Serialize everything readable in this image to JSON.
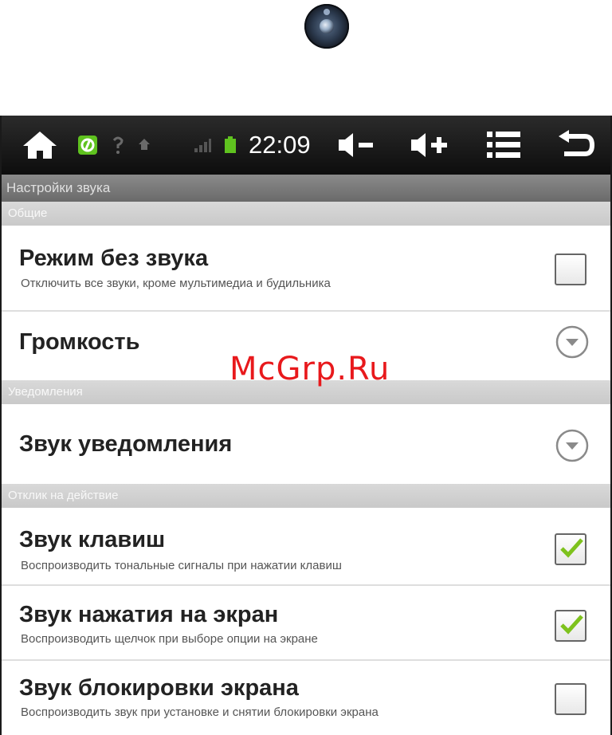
{
  "status_bar": {
    "time": "22:09",
    "icons": [
      "home-icon",
      "app-icon",
      "wifi-icon",
      "notification-icon",
      "signal-icon",
      "battery-icon",
      "volume-down-icon",
      "volume-up-icon",
      "menu-icon",
      "back-icon"
    ]
  },
  "title": "Настройки звука",
  "sections": {
    "general": "Общие",
    "notifications": "Уведомления",
    "feedback": "Отклик на действие"
  },
  "prefs": {
    "silent": {
      "title": "Режим без звука",
      "summary": "Отключить все звуки, кроме мультимедиа и будильника",
      "checked": false
    },
    "volume": {
      "title": "Громкость"
    },
    "notification_sound": {
      "title": "Звук уведомления"
    },
    "key_sound": {
      "title": "Звук клавиш",
      "summary": "Воспроизводить тональные сигналы при нажатии клавиш",
      "checked": true
    },
    "touch_sound": {
      "title": "Звук нажатия на экран",
      "summary": "Воспроизводить щелчок при выборе опции на экране",
      "checked": true
    },
    "lock_sound": {
      "title": "Звук блокировки экрана",
      "summary": "Воспроизводить звук при установке и снятии блокировки экрана",
      "checked": false
    }
  },
  "watermark": "McGrp.Ru",
  "colors": {
    "statusbar": "#111111",
    "check": "#7ec21d",
    "watermark": "#e8191c"
  }
}
